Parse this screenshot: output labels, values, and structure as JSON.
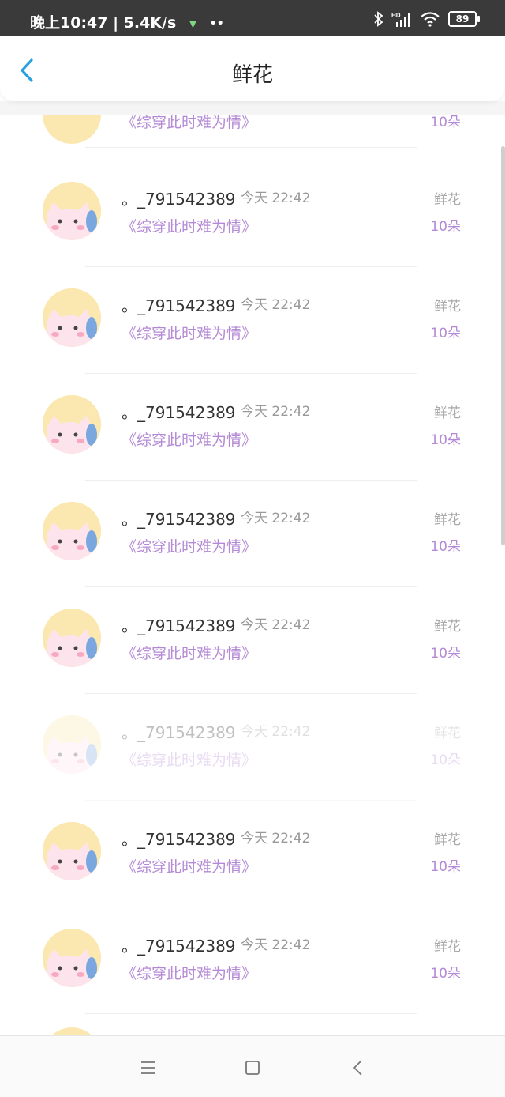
{
  "status_bar": {
    "time_and_speed": "晚上10:47 | 5.4K/s",
    "dots": "••",
    "battery": "89",
    "network": "HD"
  },
  "header": {
    "title": "鲜花"
  },
  "partial_top_row": {
    "book": "《综穿此时难为情》",
    "count": "10朵"
  },
  "rows": [
    {
      "name": "。_791542389",
      "time": "今天 22:42",
      "book": "《综穿此时难为情》",
      "gift": "鲜花",
      "count": "10朵"
    },
    {
      "name": "。_791542389",
      "time": "今天 22:42",
      "book": "《综穿此时难为情》",
      "gift": "鲜花",
      "count": "10朵"
    },
    {
      "name": "。_791542389",
      "time": "今天 22:42",
      "book": "《综穿此时难为情》",
      "gift": "鲜花",
      "count": "10朵"
    },
    {
      "name": "。_791542389",
      "time": "今天 22:42",
      "book": "《综穿此时难为情》",
      "gift": "鲜花",
      "count": "10朵"
    },
    {
      "name": "。_791542389",
      "time": "今天 22:42",
      "book": "《综穿此时难为情》",
      "gift": "鲜花",
      "count": "10朵"
    },
    {
      "name": "。_791542389",
      "time": "今天 22:42",
      "book": "《综穿此时难为情》",
      "gift": "鲜花",
      "count": "10朵"
    },
    {
      "name": "。_791542389",
      "time": "今天 22:42",
      "book": "《综穿此时难为情》",
      "gift": "鲜花",
      "count": "10朵"
    },
    {
      "name": "。_791542389",
      "time": "今天 22:42",
      "book": "《综穿此时难为情》",
      "gift": "鲜花",
      "count": "10朵"
    }
  ],
  "colors": {
    "accent": "#29a0e0",
    "purple": "#b48ad6",
    "status_bg": "#3a3a3a"
  },
  "icons": {
    "back": "chevron-left-icon",
    "menu": "menu-icon",
    "home": "square-icon",
    "nav_back": "back-triangle-icon"
  }
}
